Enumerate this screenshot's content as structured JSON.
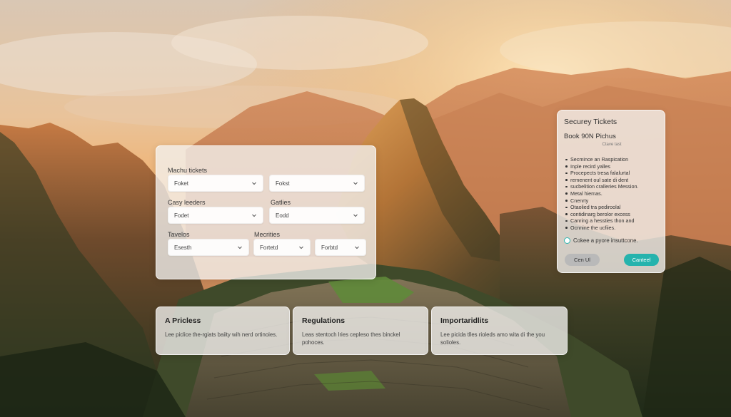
{
  "form": {
    "field1_label": "Machu tickets",
    "field1_select_a": "Foket",
    "field1_select_b": "Fokst",
    "field2_label": "Casy leeders",
    "field2b_label": "Gatlies",
    "field2_select_a": "Fodet",
    "field2_select_b": "Eodd",
    "field3_label": "Tavelos",
    "field3b_label": "Mecrities",
    "field3_select_a": "Esesth",
    "field3_select_b": "Fortetd",
    "field3_select_c": "Forbtd"
  },
  "ticket": {
    "title": "Securey Tickets",
    "subtitle": "Book 90N Pichus",
    "note": "Ctave tast",
    "items": [
      "Secmince an Raspication",
      "Inple recird yalles",
      "Procepects tresa falalurtal",
      "remenent oul sate di dent",
      "sucbelition cralleries Mession.",
      "Metal hiemas.",
      "Cnenrty",
      "Otaolied tra pediroolal",
      "contidinarg berolor excess",
      "Canring a hessties thon and",
      "Ocnnine the ucfiies."
    ],
    "check_label": "Cokee a pyore insuttcone.",
    "cancel_label": "Cen Ul",
    "confirm_label": "Canteel"
  },
  "cards": [
    {
      "title": "A Pricless",
      "body": "Lee piclice the-rgiats baiity wih nerd ortinoies."
    },
    {
      "title": "Regulations",
      "body": "Leas stentoch lries cepleso thes binckel pohoces."
    },
    {
      "title": "Importaridlits",
      "body": "Lee picida tlles rioleds amo wita di the you solioles."
    }
  ],
  "colors": {
    "accent": "#25b3ad",
    "cancel": "#b9b9b9",
    "panel": "#f4f2f0"
  },
  "icons": {
    "select": "chevron-down-icon",
    "check": "radio-circle-icon"
  }
}
